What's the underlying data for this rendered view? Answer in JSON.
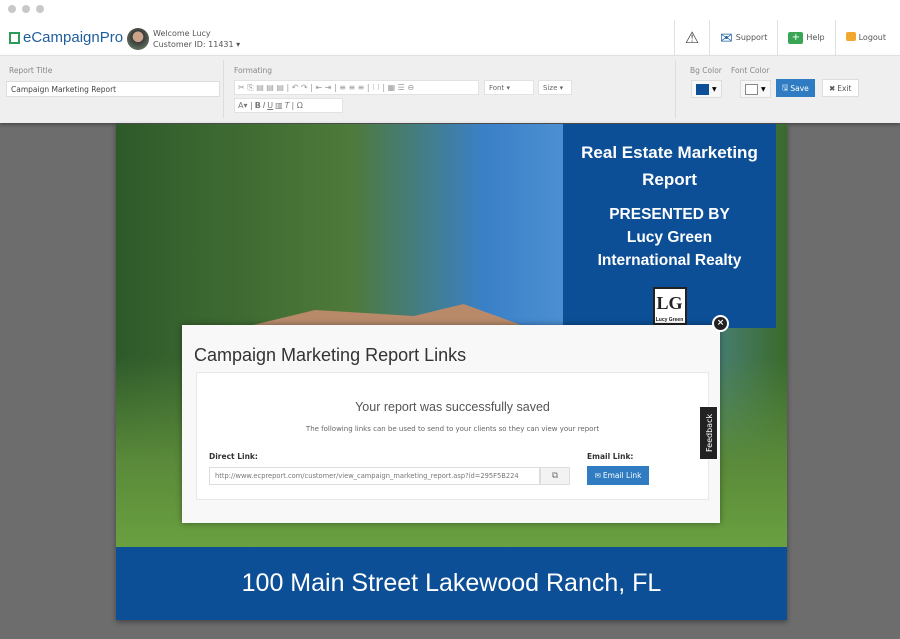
{
  "header": {
    "logo": "eCampaignPro",
    "welcome": "Welcome Lucy",
    "customer_id": "Customer ID: 11431",
    "nav": [
      {
        "label": "",
        "icon": "warning-icon"
      },
      {
        "label": "Support",
        "icon": "envelope-icon"
      },
      {
        "label": "Help",
        "icon": "medkit-icon"
      },
      {
        "label": "Logout",
        "icon": "lock-icon"
      }
    ]
  },
  "toolbar": {
    "report_title_label": "Report Title",
    "report_title_value": "Campaign Marketing Report",
    "formatting_label": "Formating",
    "font": "Font",
    "size": "Size",
    "bg_color_label": "Bg Color",
    "font_color_label": "Font Color",
    "bg_color": "#0d4f96",
    "font_color": "#ffffff",
    "save": "Save",
    "exit": "Exit"
  },
  "report": {
    "heading": "Real Estate Marketing Report",
    "presented_by": "PRESENTED BY",
    "agent": "Lucy Green",
    "company": "International Realty",
    "logo_text": "LG",
    "logo_caption": "Lucy Green",
    "address": "100 Main Street Lakewood Ranch, FL"
  },
  "modal": {
    "title": "Campaign Marketing Report Links",
    "message": "Your report was successfully saved",
    "sub": "The following links can be used to send to your clients so they can view your report",
    "direct_label": "Direct Link:",
    "direct_url": "http://www.ecpreport.com/customer/view_campaign_marketing_report.asp?id=295F5B224",
    "email_label": "Email Link:",
    "email_button": "Email Link"
  },
  "feedback": "Feedback"
}
